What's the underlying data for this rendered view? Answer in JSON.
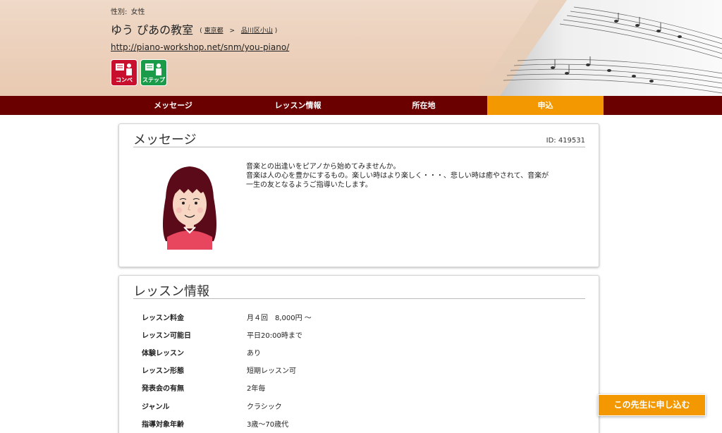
{
  "header": {
    "gender_label": "性別:",
    "gender_value": "女性",
    "teacher_name": "ゆう ぴあの教室",
    "location": {
      "open_paren": "(",
      "prefecture": "東京都",
      "separator": ">",
      "area": "品川区小山",
      "close_paren": ")"
    },
    "url": "http://piano-workshop.net/snm/you-piano/",
    "badges": [
      {
        "label": "コンペ",
        "icon": "competition-icon",
        "color": "#c8102e"
      },
      {
        "label": "ステップ",
        "icon": "step-icon",
        "color": "#1a9b4a"
      }
    ]
  },
  "nav": {
    "items": [
      "メッセージ",
      "レッスン情報",
      "所在地",
      "申込"
    ],
    "active_index": 3
  },
  "message": {
    "title": "メッセージ",
    "id_text": "ID: 419531",
    "lines": [
      "音楽との出逢いをピアノから始めてみませんか。",
      "音楽は人の心を豊かにするもの。楽しい時はより楽しく・・・、悲しい時は癒やされて、音楽が",
      "一生の友となるようご指導いたします。"
    ]
  },
  "lesson": {
    "title": "レッスン情報",
    "rows": [
      {
        "key": "レッスン料金",
        "value": "月４回　8,000円 〜"
      },
      {
        "key": "レッスン可能日",
        "value": "平日20:00時まで"
      },
      {
        "key": "体験レッスン",
        "value": "あり"
      },
      {
        "key": "レッスン形態",
        "value": "短期レッスン可"
      },
      {
        "key": "発表会の有無",
        "value": "2年毎"
      },
      {
        "key": "ジャンル",
        "value": "クラシック"
      },
      {
        "key": "指導対象年齢",
        "value": "3歳〜70歳代"
      }
    ]
  },
  "cta": {
    "label": "この先生に申し込む"
  },
  "colors": {
    "nav_bg": "#6b0000",
    "accent": "#f39800",
    "badge_red": "#c8102e",
    "badge_green": "#1a9b4a"
  }
}
